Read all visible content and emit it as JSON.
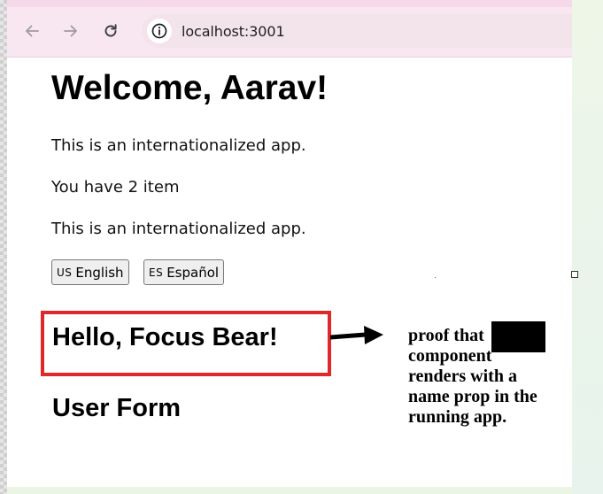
{
  "browser": {
    "url": "localhost:3001",
    "colors": {
      "tab_strip": "#f6d9e8",
      "toolbar": "#f8e7f0"
    },
    "icons": [
      "back-arrow-icon",
      "forward-arrow-icon",
      "reload-icon",
      "site-info-icon"
    ]
  },
  "page": {
    "welcome_heading": "Welcome, Aarav!",
    "intro_text": "This is an internationalized app.",
    "item_count_text": "You have 2 item",
    "intro_text_repeat": "This is an internationalized app.",
    "language_buttons": [
      {
        "flag": "US",
        "label": "English"
      },
      {
        "flag": "ES",
        "label": "Español"
      }
    ],
    "hello_heading": "Hello, Focus Bear!",
    "form_heading": "User Form"
  },
  "annotation": {
    "note_text": "proof that component renders with a name prop in the running app.",
    "highlight_color": "#e0282a"
  }
}
